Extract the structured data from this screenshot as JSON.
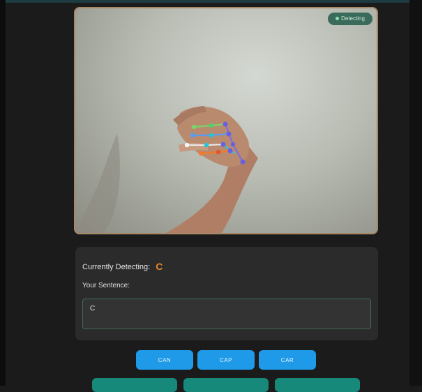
{
  "camera": {
    "status_badge": "Detecting"
  },
  "panel": {
    "currently_detecting_label": "Currently Detecting:",
    "detected_letter": "C",
    "sentence_label": "Your Sentence:",
    "sentence_value": "C"
  },
  "suggestions": [
    "CAN",
    "CAP",
    "CAR"
  ],
  "action_buttons": [
    "",
    "",
    ""
  ],
  "colors": {
    "background": "#1b1b1b",
    "panel": "#2b2b2b",
    "accent_orange": "#e8892d",
    "suggestion_blue": "#1f9ae8",
    "action_teal": "#16897a"
  }
}
